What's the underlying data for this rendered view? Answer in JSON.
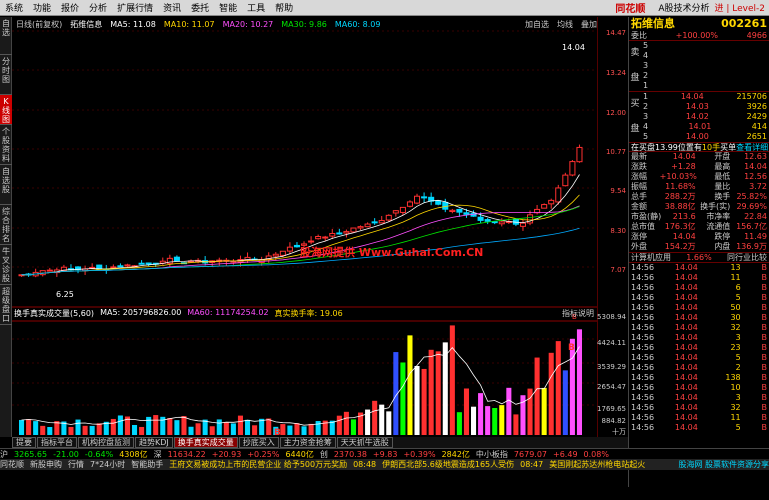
{
  "menu": {
    "items": [
      "系统",
      "功能",
      "报价",
      "分析",
      "扩展行情",
      "资讯",
      "委托",
      "智能",
      "工具",
      "帮助"
    ],
    "logo": "同花顺",
    "right": "A股技术分析",
    "level": "进 | Level-2"
  },
  "left_tabs": [
    "自选",
    "分时图",
    "K线图",
    "个股资料",
    "自选股",
    "综合排名",
    "牛叉诊股",
    "超级盘口"
  ],
  "left_active": 2,
  "info": {
    "period": "日线(前复权)",
    "name": "拓维信息",
    "ma5": "MA5: 11.08",
    "ma10": "MA10: 11.07",
    "ma20": "MA20: 10.27",
    "ma30": "MA30: 9.86",
    "ma60": "MA60: 8.09",
    "right1": "加自选",
    "right2": "均线",
    "right3": "叠加"
  },
  "price_axis": [
    "14.47",
    "13.24",
    "12.00",
    "10.77",
    "9.54",
    "8.30",
    "7.07"
  ],
  "vol_axis": [
    "5308.94",
    "4424.11",
    "3539.29",
    "2654.47",
    "1769.65",
    "884.82"
  ],
  "vol_unit": "十万",
  "high_label": "14.04",
  "low_label": "6.25",
  "watermark": "股海网提供 Www.Guhai.Com.CN",
  "vol_header": {
    "title": "换手真实成交量(5,60)",
    "ma5": "MA5: 205796826.00",
    "ma60": "MA60: 11174254.02",
    "turnover": "真实换手率: 19.06",
    "help": "指标说明"
  },
  "vol_markers": [
    "B",
    "B",
    "B"
  ],
  "bottom_tabs": [
    "提要",
    "指标平台",
    "机构控盘监测",
    "趋势KDJ",
    "换手真实成交量",
    "抄底买入",
    "主力资金抢筹",
    "天天抓牛选股"
  ],
  "bottom_active": 4,
  "right": {
    "title": "拓维信息",
    "code": "002261",
    "webi_label": "委比",
    "webi": "+100.00%",
    "webi_diff": "4966",
    "sell_label": "卖",
    "pan_label": "盘",
    "buy_label": "买",
    "sells": [
      [
        "5",
        "",
        ""
      ],
      [
        "4",
        "",
        ""
      ],
      [
        "3",
        "",
        ""
      ],
      [
        "2",
        "",
        ""
      ],
      [
        "1",
        "",
        ""
      ]
    ],
    "buys": [
      [
        "1",
        "14.04",
        "215706"
      ],
      [
        "2",
        "14.03",
        "3926"
      ],
      [
        "3",
        "14.02",
        "2429"
      ],
      [
        "4",
        "14.01",
        "414"
      ],
      [
        "5",
        "14.00",
        "2651"
      ]
    ],
    "zt_note": "在买盘13.99位置有",
    "zt_count": "10手",
    "zt_buy": "买单",
    "zt_view": "查看详细",
    "stats": [
      [
        "最新",
        "14.04",
        "开盘",
        "12.63"
      ],
      [
        "涨跌",
        "+1.28",
        "最高",
        "14.04"
      ],
      [
        "涨幅",
        "+10.03%",
        "最低",
        "12.56"
      ],
      [
        "振幅",
        "11.68%",
        "量比",
        "3.72"
      ],
      [
        "总手",
        "288.2万",
        "换手",
        "25.82%"
      ],
      [
        "金额",
        "38.88亿",
        "换手(实)",
        "29.69%"
      ],
      [
        "市盈(静)",
        "213.6",
        "市净率",
        "22.84"
      ],
      [
        "总市值",
        "176.3亿",
        "流通值",
        "156.7亿"
      ],
      [
        "涨停",
        "14.04",
        "跌停",
        "11.49"
      ],
      [
        "外盘",
        "154.2万",
        "内盘",
        "136.9万"
      ]
    ],
    "industry": "计算机应用",
    "industry_pct": "1.66%",
    "compare": "同行业比较",
    "ticks": [
      [
        "14:56",
        "14.04",
        "13",
        "B"
      ],
      [
        "14:56",
        "14.04",
        "11",
        "B"
      ],
      [
        "14:56",
        "14.04",
        "6",
        "B"
      ],
      [
        "14:56",
        "14.04",
        "5",
        "B"
      ],
      [
        "14:56",
        "14.04",
        "50",
        "B"
      ],
      [
        "14:56",
        "14.04",
        "30",
        "B"
      ],
      [
        "14:56",
        "14.04",
        "32",
        "B"
      ],
      [
        "14:56",
        "14.04",
        "3",
        "B"
      ],
      [
        "14:56",
        "14.04",
        "23",
        "B"
      ],
      [
        "14:56",
        "14.04",
        "5",
        "B"
      ],
      [
        "14:56",
        "14.04",
        "2",
        "B"
      ],
      [
        "14:56",
        "14.04",
        "138",
        "B"
      ],
      [
        "14:56",
        "14.04",
        "10",
        "B"
      ],
      [
        "14:56",
        "14.04",
        "3",
        "B"
      ],
      [
        "14:56",
        "14.04",
        "32",
        "B"
      ],
      [
        "14:56",
        "14.04",
        "11",
        "B"
      ],
      [
        "14:56",
        "14.04",
        "5",
        "B"
      ]
    ]
  },
  "status1": {
    "sh_label": "沪",
    "sh_val": "3265.65",
    "sh_chg": "-21.00",
    "sh_pct": "-0.64%",
    "sh_amt": "4308亿",
    "sz_label": "深",
    "sz_val": "11634.22",
    "sz_chg": "+20.93",
    "sz_pct": "+0.25%",
    "sz_amt": "6440亿",
    "cy_label": "创",
    "cy_val": "2370.38",
    "cy_chg": "+9.83",
    "cy_pct": "+0.39%",
    "cy_amt": "2842亿",
    "sme": "中小板指",
    "sme_val": "7679.07",
    "sme_pct": "+6.49",
    "num": "0.08%"
  },
  "status2": {
    "items": [
      "同花顺",
      "新股申购",
      "行情",
      "7*24小时",
      "智能助手"
    ],
    "news1": "王府文易被成功上市的民营企业 给予500万元奖励",
    "time1": "08:48",
    "news2": "伊朗西北部5.6级地震造成165人受伤",
    "time2": "08:47",
    "news3": "美国刚起苏达州枪电站起火",
    "ad": "股海网 股票软件资源分享",
    "ad_url": "www.guhai.com.cn"
  }
}
